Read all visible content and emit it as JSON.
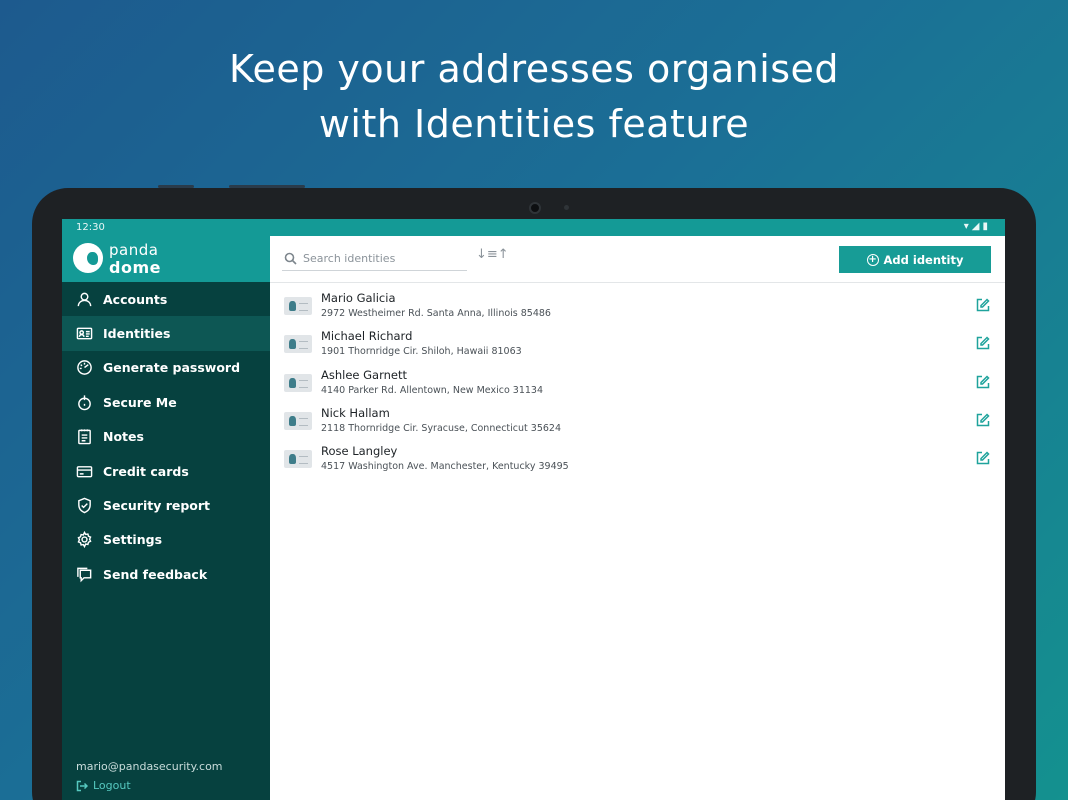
{
  "promo": {
    "headline_line1": "Keep your addresses organised",
    "headline_line2": "with Identities feature"
  },
  "status_bar": {
    "time": "12:30",
    "system_icons": "▾◢▮"
  },
  "brand": {
    "word1": "panda",
    "word2": "dome"
  },
  "sidebar": {
    "items": [
      {
        "label": "Accounts",
        "icon": "user-icon",
        "active": false
      },
      {
        "label": "Identities",
        "icon": "id-card-icon",
        "active": true
      },
      {
        "label": "Generate password",
        "icon": "password-generator-icon",
        "active": false
      },
      {
        "label": "Secure Me",
        "icon": "secure-me-icon",
        "active": false
      },
      {
        "label": "Notes",
        "icon": "notes-icon",
        "active": false
      },
      {
        "label": "Credit cards",
        "icon": "credit-card-icon",
        "active": false
      },
      {
        "label": "Security report",
        "icon": "shield-check-icon",
        "active": false
      },
      {
        "label": "Settings",
        "icon": "gear-icon",
        "active": false
      },
      {
        "label": "Send feedback",
        "icon": "feedback-icon",
        "active": false
      }
    ],
    "user_email": "mario@pandasecurity.com",
    "logout_label": "Logout"
  },
  "toolbar": {
    "search_placeholder": "Search identities",
    "sort_glyph": "↓≡↑",
    "add_label": "Add identity"
  },
  "identities": [
    {
      "name": "Mario Galicia",
      "address": "2972 Westheimer Rd. Santa Anna, Illinois 85486"
    },
    {
      "name": "Michael Richard",
      "address": "1901 Thornridge Cir. Shiloh, Hawaii 81063"
    },
    {
      "name": "Ashlee Garnett",
      "address": "4140 Parker Rd. Allentown, New Mexico 31134"
    },
    {
      "name": "Nick Hallam",
      "address": "2118 Thornridge Cir. Syracuse, Connecticut 35624"
    },
    {
      "name": "Rose Langley",
      "address": "4517 Washington Ave. Manchester, Kentucky 39495"
    }
  ],
  "colors": {
    "accent": "#179c96",
    "sidebar_bg": "#06413f",
    "sidebar_active": "#0d5754"
  }
}
